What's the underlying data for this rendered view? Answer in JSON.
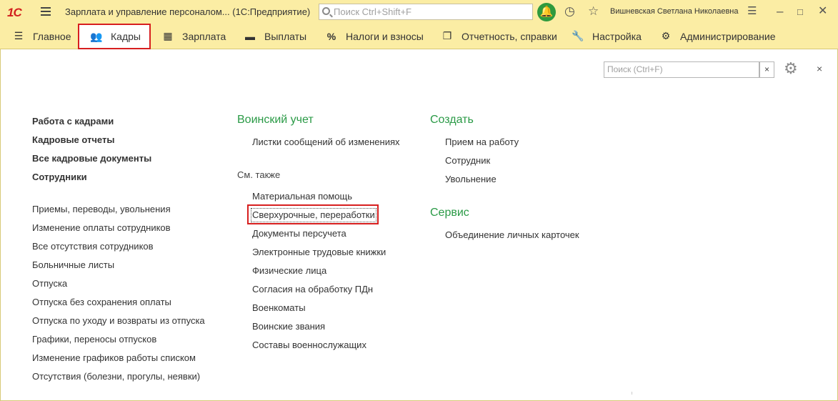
{
  "titlebar": {
    "logo": "1С",
    "app_title": "Зарплата и управление персоналом...  (1С:Предприятие)",
    "search_placeholder": "Поиск Ctrl+Shift+F",
    "user_name": "Вишневская Светлана Николаевна"
  },
  "sections": [
    {
      "label": "Главное",
      "icon": "menu-icon"
    },
    {
      "label": "Кадры",
      "icon": "people-icon"
    },
    {
      "label": "Зарплата",
      "icon": "calculator-icon"
    },
    {
      "label": "Выплаты",
      "icon": "wallet-icon"
    },
    {
      "label": "Налоги и взносы",
      "icon": "percent-icon"
    },
    {
      "label": "Отчетность, справки",
      "icon": "reports-icon"
    },
    {
      "label": "Настройка",
      "icon": "wrench-icon"
    },
    {
      "label": "Администрирование",
      "icon": "gear-icon"
    }
  ],
  "content": {
    "search_placeholder": "Поиск (Ctrl+F)",
    "clear_label": "×",
    "close_label": "×",
    "col1_bold": [
      "Работа с кадрами",
      "Кадровые отчеты",
      "Все кадровые документы",
      "Сотрудники"
    ],
    "col1_links": [
      "Приемы, переводы, увольнения",
      "Изменение оплаты сотрудников",
      "Все отсутствия сотрудников",
      "Больничные листы",
      "Отпуска",
      "Отпуска без сохранения оплаты",
      "Отпуска по уходу и возвраты из отпуска",
      "Графики, переносы отпусков",
      "Изменение графиков работы списком",
      "Отсутствия (болезни, прогулы, неявки)"
    ],
    "col2_group_title": "Воинский учет",
    "col2_group_links": [
      "Листки сообщений об изменениях"
    ],
    "col2_see_also": "См. также",
    "col2_see_also_links": [
      "Материальная помощь",
      "Сверхурочные, переработки",
      "Документы персучета",
      "Электронные трудовые книжки",
      "Физические лица",
      "Согласия на обработку ПДн",
      "Военкоматы",
      "Воинские звания",
      "Составы военнослужащих"
    ],
    "col3_create_title": "Создать",
    "col3_create_links": [
      "Прием на работу",
      "Сотрудник",
      "Увольнение"
    ],
    "col3_service_title": "Сервис",
    "col3_service_links": [
      "Объединение личных карточек"
    ]
  },
  "colors": {
    "panel_bg": "#fbeda4",
    "group_title": "#2a9a46",
    "highlight": "#d71f1f",
    "logo": "#d2201e"
  }
}
